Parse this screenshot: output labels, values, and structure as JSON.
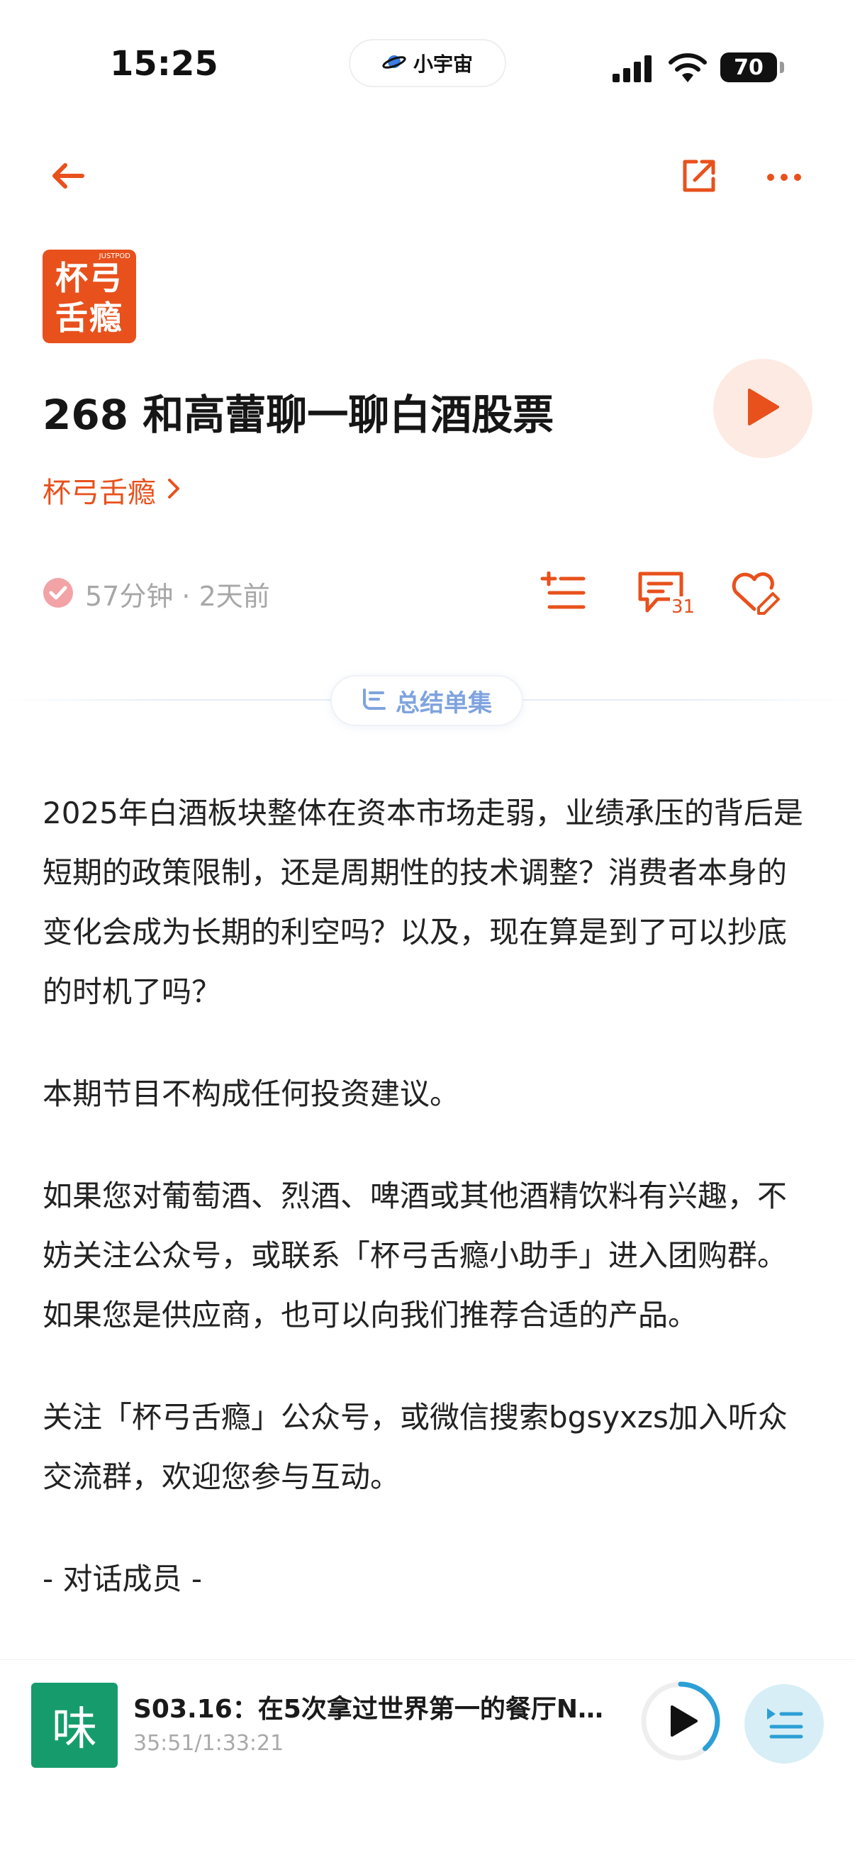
{
  "status_bar": {
    "time": "15:25",
    "island_label": "小宇宙",
    "battery": "70"
  },
  "podcast": {
    "cover_tag": "JUSTPOD",
    "cover_text": "杯弓\n舌瘾",
    "name": "杯弓舌瘾"
  },
  "episode": {
    "title": "268 和高蕾聊一聊白酒股票",
    "meta": "57分钟 · 2天前",
    "comment_count": "31",
    "summary_label": "总结单集"
  },
  "description": {
    "paragraphs": [
      "2025年白酒板块整体在资本市场走弱，业绩承压的背后是短期的政策限制，还是周期性的技术调整？消费者本身的变化会成为长期的利空吗？以及，现在算是到了可以抄底的时机了吗？",
      "本期节目不构成任何投资建议。",
      "如果您对葡萄酒、烈酒、啤酒或其他酒精饮料有兴趣，不妨关注公众号，或联系「杯弓舌瘾小助手」进入团购群。如果您是供应商，也可以向我们推荐合适的产品。",
      "关注「杯弓舌瘾」公众号，或微信搜索bgsyxzs加入听众交流群，欢迎您参与互动。",
      "- 对话成员 -"
    ]
  },
  "mini_player": {
    "cover_char": "味",
    "title": "S03.16：在5次拿过世界第一的餐厅N…",
    "time": "35:51/1:33:21",
    "progress": 0.384
  },
  "colors": {
    "accent": "#e8511c",
    "summary": "#7fa3de",
    "mini_accent": "#2c9fd6"
  }
}
